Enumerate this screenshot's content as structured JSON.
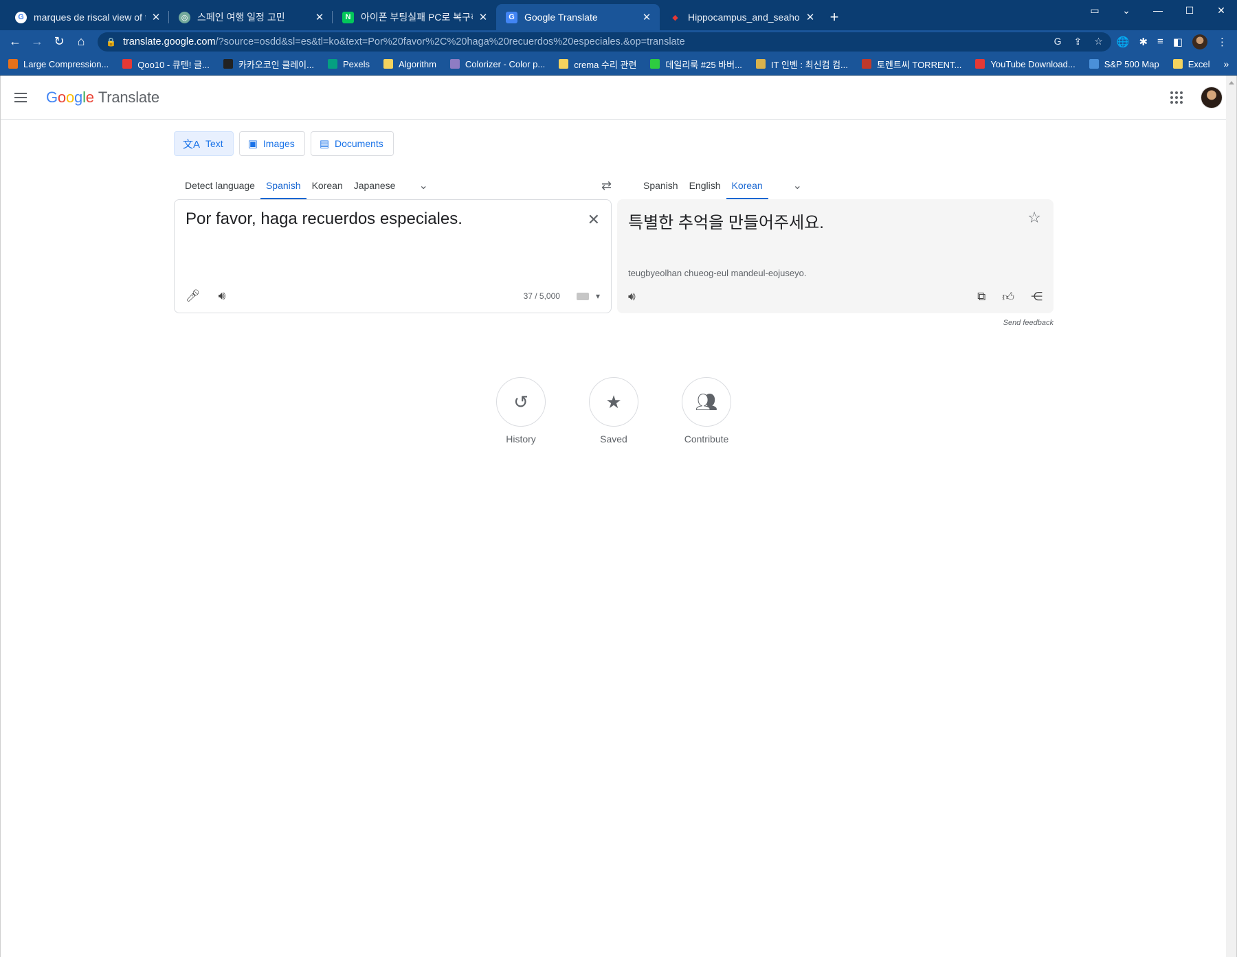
{
  "browser": {
    "tabs": [
      {
        "title": "marques de riscal view of the to",
        "favicon": "google-icon",
        "active": false
      },
      {
        "title": "스페인 여행 일정 고민",
        "favicon": "chatgpt-icon",
        "active": false
      },
      {
        "title": "아이폰 부팅실패 PC로 복구하기",
        "favicon": "naver-icon",
        "active": false
      },
      {
        "title": "Google Translate",
        "favicon": "google-translate-icon",
        "active": true
      },
      {
        "title": "Hippocampus_and_seahorse_cro",
        "favicon": "wikipedia-icon",
        "active": false
      }
    ],
    "url_host": "translate.google.com",
    "url_rest": "/?source=osdd&sl=es&tl=ko&text=Por%20favor%2C%20haga%20recuerdos%20especiales.&op=translate",
    "bookmarks": [
      {
        "label": "Large Compression...",
        "color": "#e8711a"
      },
      {
        "label": "Qoo10 - 큐텐! 글...",
        "color": "#e53935"
      },
      {
        "label": "카카오코인 클레이...",
        "color": "#222222"
      },
      {
        "label": "Pexels",
        "color": "#05a081"
      },
      {
        "label": "Algorithm",
        "color": "#f4d35e"
      },
      {
        "label": "Colorizer - Color p...",
        "color": "#8e7cc3"
      },
      {
        "label": "crema 수리 관련",
        "color": "#f4d35e"
      },
      {
        "label": "데일리룩 #25 바버...",
        "color": "#2ecc40"
      },
      {
        "label": "IT 인벤 : 최신컴 컴...",
        "color": "#d9b24c"
      },
      {
        "label": "토렌트씨 TORRENT...",
        "color": "#c0392b"
      },
      {
        "label": "YouTube Download...",
        "color": "#e53935"
      },
      {
        "label": "S&P 500 Map",
        "color": "#4a90d9"
      },
      {
        "label": "Excel",
        "color": "#f4d35e"
      }
    ],
    "bookmarks_more": "»"
  },
  "app": {
    "logo_google": [
      "G",
      "o",
      "o",
      "g",
      "l",
      "e"
    ],
    "logo_translate": "Translate"
  },
  "modes": [
    {
      "label": "Text",
      "active": true
    },
    {
      "label": "Images",
      "active": false
    },
    {
      "label": "Documents",
      "active": false
    }
  ],
  "source_langs": [
    {
      "label": "Detect language",
      "selected": false
    },
    {
      "label": "Spanish",
      "selected": true
    },
    {
      "label": "Korean",
      "selected": false
    },
    {
      "label": "Japanese",
      "selected": false
    }
  ],
  "target_langs": [
    {
      "label": "Spanish",
      "selected": false
    },
    {
      "label": "English",
      "selected": false
    },
    {
      "label": "Korean",
      "selected": true
    }
  ],
  "source": {
    "text": "Por favor, haga recuerdos especiales.",
    "char_count": "37 / 5,000"
  },
  "target": {
    "text": "특별한 추억을 만들어주세요.",
    "romanization": "teugbyeolhan chueog-eul mandeul-eojuseyo."
  },
  "feedback_label": "Send feedback",
  "actions": [
    {
      "label": "History",
      "icon": "history-icon"
    },
    {
      "label": "Saved",
      "icon": "star-icon"
    },
    {
      "label": "Contribute",
      "icon": "people-icon"
    }
  ]
}
